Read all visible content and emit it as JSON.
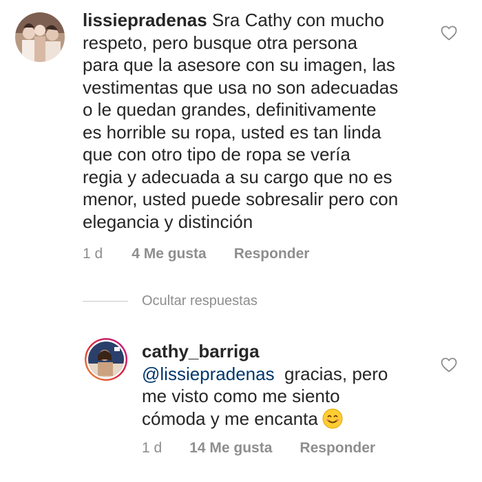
{
  "comment1": {
    "username": "lissiepradenas",
    "text_lines": [
      " Sra Cathy con mucho",
      "respeto, pero busque otra persona",
      "para que la asesore con su imagen, las",
      "vestimentas que usa no son adecuadas",
      "o  le quedan grandes,  definitivamente",
      "es horrible su ropa, usted es tan linda",
      "que con otro tipo de ropa se vería",
      "regia y  adecuada a su cargo que no es",
      "menor, usted puede sobresalir pero con",
      "elegancia y distinción"
    ],
    "time": "1 d",
    "likes": "4 Me gusta",
    "reply_label": "Responder",
    "avatar_icon": "profile-photo-icon",
    "like_icon": "heart-outline-icon"
  },
  "hide_replies_label": "Ocultar respuestas",
  "reply1": {
    "username": "cathy_barriga",
    "mention": "@lissiepradenas",
    "text_first": "  gracias, pero",
    "text_lines": [
      "me visto como me siento",
      "cómoda y me encanta"
    ],
    "emoji": "smiling-face-emoji",
    "time": "1 d",
    "likes": "14 Me gusta",
    "reply_label": "Responder",
    "avatar_icon": "profile-photo-story-ring-icon",
    "like_icon": "heart-outline-icon"
  },
  "colors": {
    "text": "#262626",
    "muted": "#8e8e8e",
    "mention": "#00376b",
    "story_ring_start": "#f09433",
    "story_ring_end": "#bc1888"
  }
}
